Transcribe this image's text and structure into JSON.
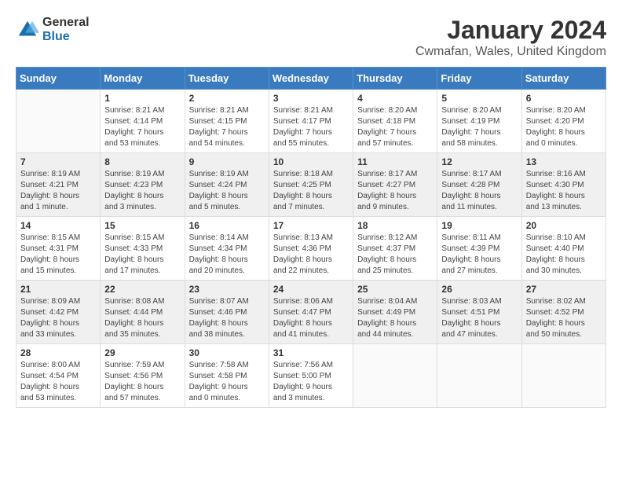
{
  "logo": {
    "general": "General",
    "blue": "Blue"
  },
  "title": "January 2024",
  "subtitle": "Cwmafan, Wales, United Kingdom",
  "weekdays": [
    "Sunday",
    "Monday",
    "Tuesday",
    "Wednesday",
    "Thursday",
    "Friday",
    "Saturday"
  ],
  "weeks": [
    [
      {
        "day": "",
        "info": ""
      },
      {
        "day": "1",
        "info": "Sunrise: 8:21 AM\nSunset: 4:14 PM\nDaylight: 7 hours\nand 53 minutes."
      },
      {
        "day": "2",
        "info": "Sunrise: 8:21 AM\nSunset: 4:15 PM\nDaylight: 7 hours\nand 54 minutes."
      },
      {
        "day": "3",
        "info": "Sunrise: 8:21 AM\nSunset: 4:17 PM\nDaylight: 7 hours\nand 55 minutes."
      },
      {
        "day": "4",
        "info": "Sunrise: 8:20 AM\nSunset: 4:18 PM\nDaylight: 7 hours\nand 57 minutes."
      },
      {
        "day": "5",
        "info": "Sunrise: 8:20 AM\nSunset: 4:19 PM\nDaylight: 7 hours\nand 58 minutes."
      },
      {
        "day": "6",
        "info": "Sunrise: 8:20 AM\nSunset: 4:20 PM\nDaylight: 8 hours\nand 0 minutes."
      }
    ],
    [
      {
        "day": "7",
        "info": "Sunrise: 8:19 AM\nSunset: 4:21 PM\nDaylight: 8 hours\nand 1 minute."
      },
      {
        "day": "8",
        "info": "Sunrise: 8:19 AM\nSunset: 4:23 PM\nDaylight: 8 hours\nand 3 minutes."
      },
      {
        "day": "9",
        "info": "Sunrise: 8:19 AM\nSunset: 4:24 PM\nDaylight: 8 hours\nand 5 minutes."
      },
      {
        "day": "10",
        "info": "Sunrise: 8:18 AM\nSunset: 4:25 PM\nDaylight: 8 hours\nand 7 minutes."
      },
      {
        "day": "11",
        "info": "Sunrise: 8:17 AM\nSunset: 4:27 PM\nDaylight: 8 hours\nand 9 minutes."
      },
      {
        "day": "12",
        "info": "Sunrise: 8:17 AM\nSunset: 4:28 PM\nDaylight: 8 hours\nand 11 minutes."
      },
      {
        "day": "13",
        "info": "Sunrise: 8:16 AM\nSunset: 4:30 PM\nDaylight: 8 hours\nand 13 minutes."
      }
    ],
    [
      {
        "day": "14",
        "info": "Sunrise: 8:15 AM\nSunset: 4:31 PM\nDaylight: 8 hours\nand 15 minutes."
      },
      {
        "day": "15",
        "info": "Sunrise: 8:15 AM\nSunset: 4:33 PM\nDaylight: 8 hours\nand 17 minutes."
      },
      {
        "day": "16",
        "info": "Sunrise: 8:14 AM\nSunset: 4:34 PM\nDaylight: 8 hours\nand 20 minutes."
      },
      {
        "day": "17",
        "info": "Sunrise: 8:13 AM\nSunset: 4:36 PM\nDaylight: 8 hours\nand 22 minutes."
      },
      {
        "day": "18",
        "info": "Sunrise: 8:12 AM\nSunset: 4:37 PM\nDaylight: 8 hours\nand 25 minutes."
      },
      {
        "day": "19",
        "info": "Sunrise: 8:11 AM\nSunset: 4:39 PM\nDaylight: 8 hours\nand 27 minutes."
      },
      {
        "day": "20",
        "info": "Sunrise: 8:10 AM\nSunset: 4:40 PM\nDaylight: 8 hours\nand 30 minutes."
      }
    ],
    [
      {
        "day": "21",
        "info": "Sunrise: 8:09 AM\nSunset: 4:42 PM\nDaylight: 8 hours\nand 33 minutes."
      },
      {
        "day": "22",
        "info": "Sunrise: 8:08 AM\nSunset: 4:44 PM\nDaylight: 8 hours\nand 35 minutes."
      },
      {
        "day": "23",
        "info": "Sunrise: 8:07 AM\nSunset: 4:46 PM\nDaylight: 8 hours\nand 38 minutes."
      },
      {
        "day": "24",
        "info": "Sunrise: 8:06 AM\nSunset: 4:47 PM\nDaylight: 8 hours\nand 41 minutes."
      },
      {
        "day": "25",
        "info": "Sunrise: 8:04 AM\nSunset: 4:49 PM\nDaylight: 8 hours\nand 44 minutes."
      },
      {
        "day": "26",
        "info": "Sunrise: 8:03 AM\nSunset: 4:51 PM\nDaylight: 8 hours\nand 47 minutes."
      },
      {
        "day": "27",
        "info": "Sunrise: 8:02 AM\nSunset: 4:52 PM\nDaylight: 8 hours\nand 50 minutes."
      }
    ],
    [
      {
        "day": "28",
        "info": "Sunrise: 8:00 AM\nSunset: 4:54 PM\nDaylight: 8 hours\nand 53 minutes."
      },
      {
        "day": "29",
        "info": "Sunrise: 7:59 AM\nSunset: 4:56 PM\nDaylight: 8 hours\nand 57 minutes."
      },
      {
        "day": "30",
        "info": "Sunrise: 7:58 AM\nSunset: 4:58 PM\nDaylight: 9 hours\nand 0 minutes."
      },
      {
        "day": "31",
        "info": "Sunrise: 7:56 AM\nSunset: 5:00 PM\nDaylight: 9 hours\nand 3 minutes."
      },
      {
        "day": "",
        "info": ""
      },
      {
        "day": "",
        "info": ""
      },
      {
        "day": "",
        "info": ""
      }
    ]
  ],
  "colors": {
    "header_bg": "#3a7abf",
    "alt_row": "#f0f4f8"
  }
}
